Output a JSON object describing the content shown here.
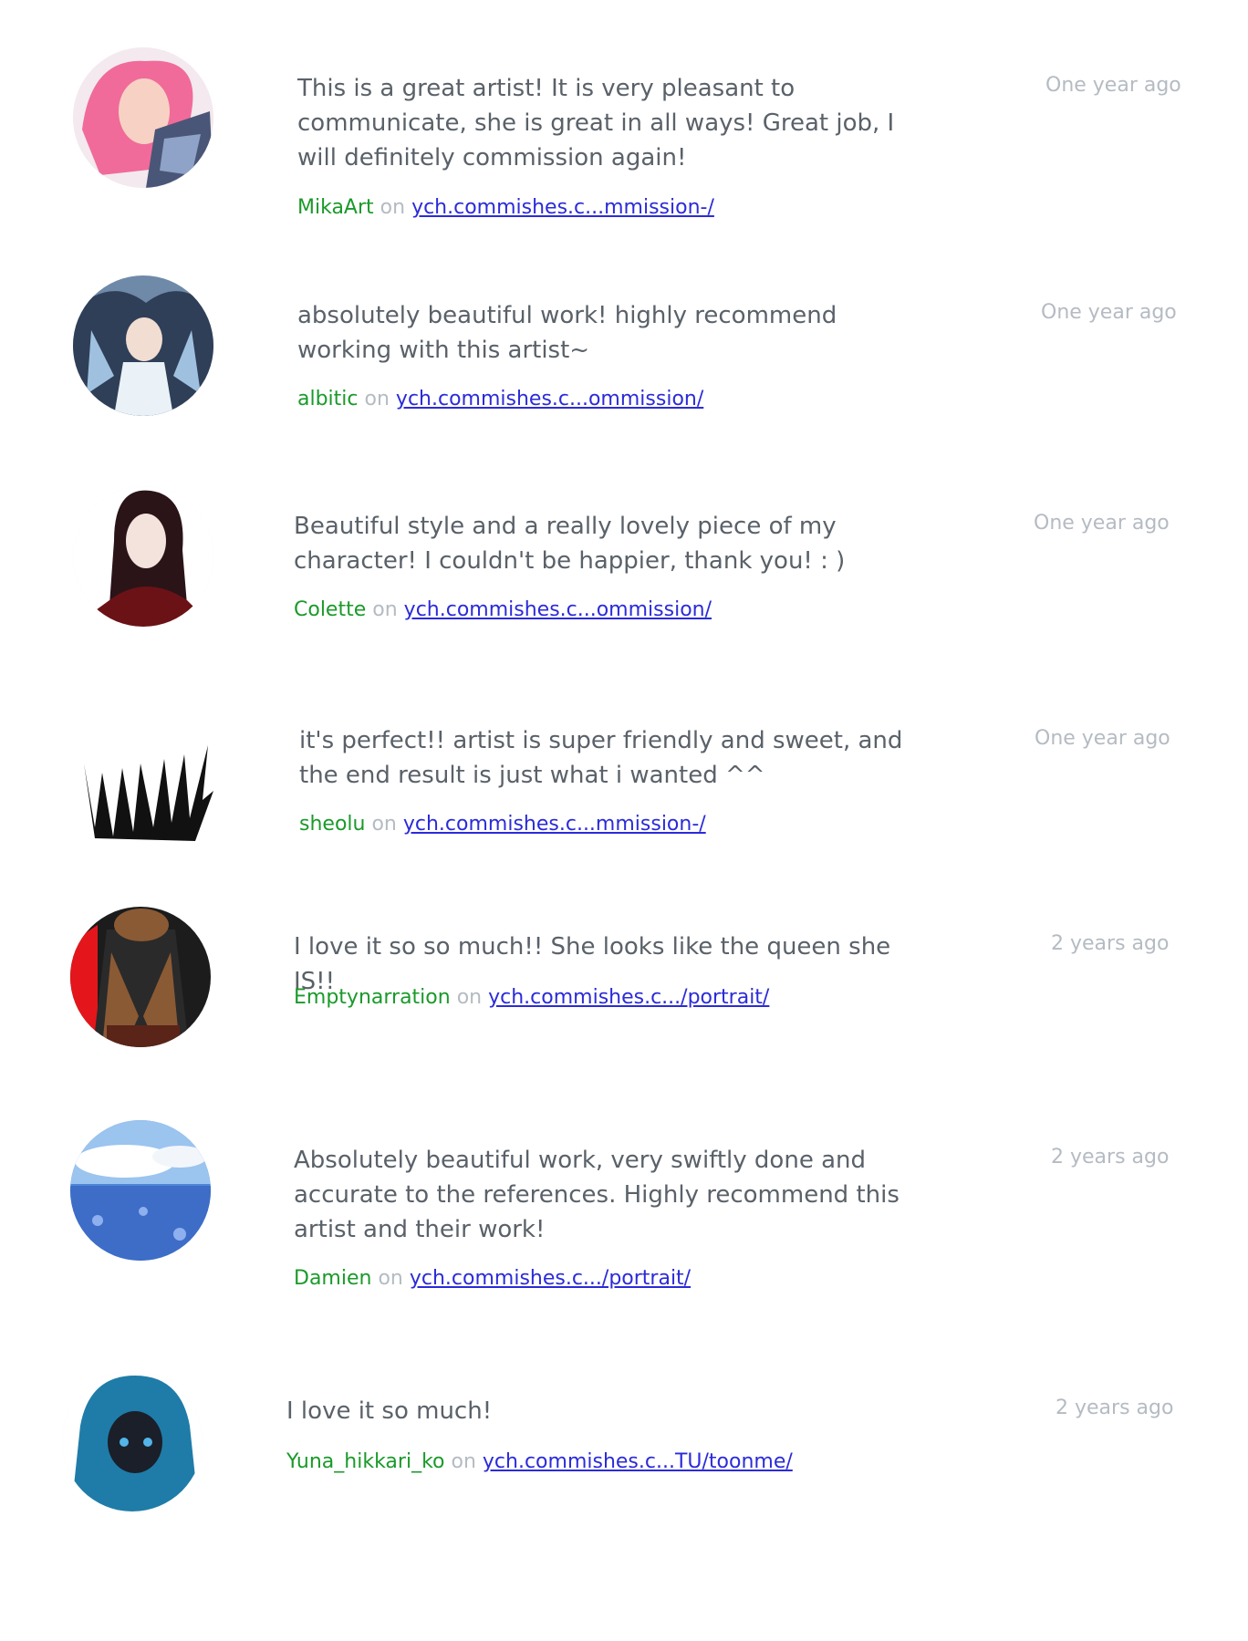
{
  "connector": "on",
  "reviews": [
    {
      "text": "This is a great artist! It is very pleasant to communicate, she is great in all ways! Great job, I will definitely commission again!",
      "author": "MikaArt",
      "link": "ych.commishes.c...mmission-/",
      "time": "One year ago"
    },
    {
      "text": "absolutely beautiful work! highly recommend working with this artist~",
      "author": "albitic",
      "link": "ych.commishes.c...ommission/",
      "time": "One year ago"
    },
    {
      "text": "Beautiful style and a really lovely piece of my character! I couldn't be happier, thank you! : )",
      "author": "Colette",
      "link": "ych.commishes.c...ommission/",
      "time": "One year ago"
    },
    {
      "text": "it's perfect!! artist is super friendly and sweet, and the end result is just what i wanted ^^",
      "author": "sheolu",
      "link": "ych.commishes.c...mmission-/",
      "time": "One year ago"
    },
    {
      "text": "I love it so so much!! She looks like the queen she IS!!",
      "author": "Emptynarration",
      "link": "ych.commishes.c.../portrait/",
      "time": "2 years ago"
    },
    {
      "text": "Absolutely beautiful work, very swiftly done and accurate to the references. Highly recommend this artist and their work!",
      "author": "Damien",
      "link": "ych.commishes.c.../portrait/",
      "time": "2 years ago"
    },
    {
      "text": "I love it so much!",
      "author": "Yuna_hikkari_ko",
      "link": "ych.commishes.c...TU/toonme/",
      "time": "2 years ago"
    }
  ],
  "colors": {
    "author": "#1a9a2a",
    "link": "#2b2bd9",
    "muted": "#b5bbc2",
    "text": "#5a6169"
  }
}
